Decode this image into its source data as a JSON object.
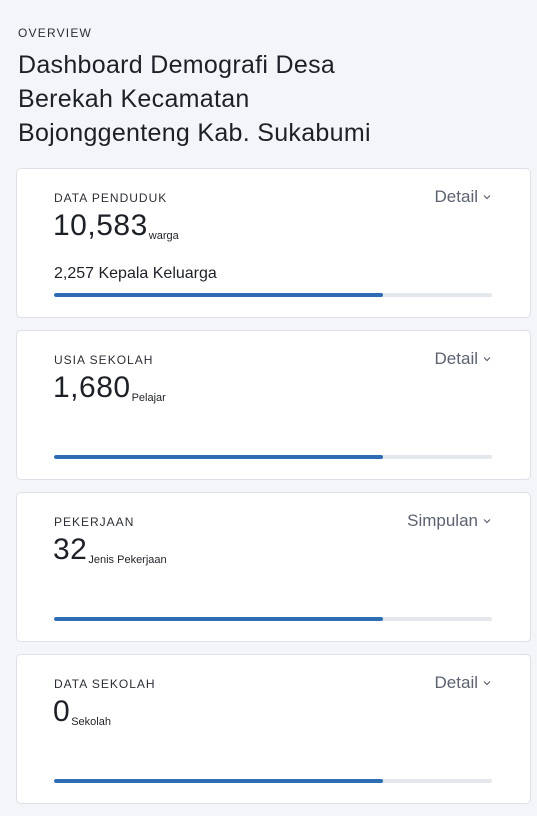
{
  "header": {
    "overline": "OVERVIEW",
    "title_lines": [
      "Dashboard Demografi Desa",
      "Berekah Kecamatan",
      "Bojonggenteng Kab. Sukabumi"
    ]
  },
  "colors": {
    "accent": "#2e6db4",
    "track": "#e4e7eb",
    "background": "#f3f5f8"
  },
  "cards": [
    {
      "label": "DATA PENDUDUK",
      "action": "Detail",
      "action_icon": "chevron-down-icon",
      "value": "10,583",
      "unit": "warga",
      "sub_stat": "2,257 Kepala Keluarga",
      "progress": 0.75
    },
    {
      "label": "USIA SEKOLAH",
      "action": "Detail",
      "action_icon": "chevron-down-icon",
      "value": "1,680",
      "unit": "Pelajar",
      "sub_stat": "",
      "progress": 0.75
    },
    {
      "label": "PEKERJAAN",
      "action": "Simpulan",
      "action_icon": "chevron-down-icon",
      "value": "32",
      "unit": "Jenis Pekerjaan",
      "sub_stat": "",
      "progress": 0.75
    },
    {
      "label": "DATA SEKOLAH",
      "action": "Detail",
      "action_icon": "chevron-down-icon",
      "value": "0",
      "unit": "Sekolah",
      "sub_stat": "",
      "progress": 0.75
    }
  ]
}
